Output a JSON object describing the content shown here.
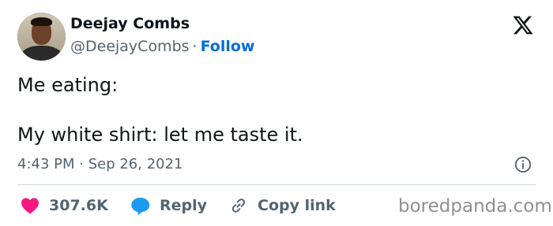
{
  "author": {
    "name": "Deejay Combs",
    "handle": "@DeejayCombs",
    "separator": "·",
    "follow_label": "Follow"
  },
  "tweet": {
    "line1": "Me eating:",
    "line2": "My white shirt: let me taste it.",
    "timestamp": "4:43 PM · Sep 26, 2021"
  },
  "actions": {
    "likes": "307.6K",
    "reply_label": "Reply",
    "copy_label": "Copy link"
  },
  "watermark": "boredpanda.com",
  "icons": {
    "logo": "x-logo-icon",
    "info": "info-icon",
    "like": "heart-icon",
    "reply": "speech-bubble-icon",
    "copy": "link-icon"
  },
  "colors": {
    "follow": "#006fd6",
    "heart": "#f91880",
    "reply_bubble": "#1d9bf0",
    "secondary_text": "#536471"
  }
}
